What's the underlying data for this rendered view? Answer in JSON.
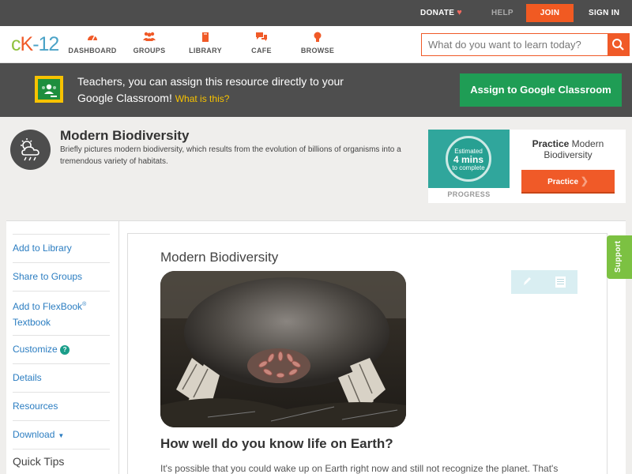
{
  "topbar": {
    "donate": "DONATE",
    "help": "HELP",
    "join": "JOIN",
    "signin": "SIGN IN"
  },
  "logo": {
    "c": "c",
    "k": "K",
    "num": "-12"
  },
  "nav": {
    "dashboard": "DASHBOARD",
    "groups": "GROUPS",
    "library": "LIBRARY",
    "cafe": "CAFE",
    "browse": "BROWSE"
  },
  "search": {
    "placeholder": "What do you want to learn today?"
  },
  "banner": {
    "text": "Teachers, you can assign this resource directly to your Google Classroom!",
    "what": "What is this?",
    "button": "Assign to Google Classroom"
  },
  "concept": {
    "title": "Modern Biodiversity",
    "description": "Briefly pictures modern biodiversity, which results from the evolution of billions of organisms into a tremendous variety of habitats."
  },
  "practice": {
    "estimated": "Estimated",
    "mins": "4 mins",
    "to_complete": "to complete",
    "progress": "PROGRESS",
    "label_bold": "Practice",
    "label_rest": "Modern Biodiversity",
    "button": "Practice"
  },
  "sidebar": {
    "add_library": "Add to Library",
    "share_groups": "Share to Groups",
    "add_flexbook": "Add to FlexBook",
    "reg": "®",
    "textbook": "Textbook",
    "customize": "Customize",
    "details": "Details",
    "resources": "Resources",
    "download": "Download",
    "quick_tips": "Quick Tips"
  },
  "content": {
    "title": "Modern Biodiversity",
    "heading": "How well do you know life on Earth?",
    "paragraph": "It's possible that you could wake up on Earth right now and still not recognize the planet. That's"
  },
  "support": "Support",
  "colors": {
    "accent": "#f05a28",
    "green": "#1f9d55",
    "link": "#2b7dc1",
    "teal": "#30a69c"
  }
}
